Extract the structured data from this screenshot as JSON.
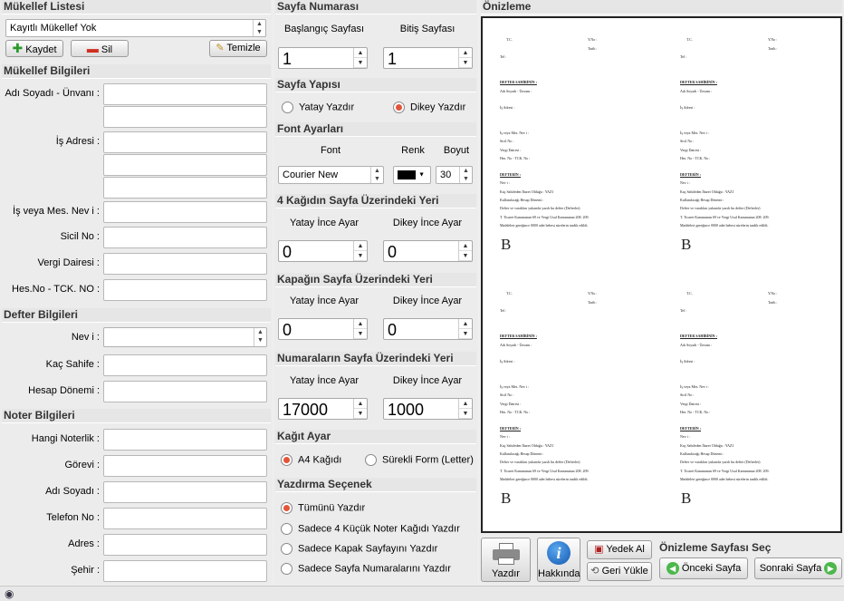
{
  "mukellef_listesi": {
    "title": "Mükellef Listesi",
    "selected": "Kayıtlı Mükellef Yok",
    "kaydet": "Kaydet",
    "sil": "Sil",
    "temizle": "Temizle"
  },
  "mukellef_bilgileri": {
    "title": "Mükellef Bilgileri",
    "ad_soyad": "Adı Soyadı - Ünvanı :",
    "is_adresi": "İş Adresi :",
    "mes_nev": "İş veya Mes. Nev i :",
    "sicil": "Sicil No :",
    "vergi": "Vergi Dairesi :",
    "hes_no": "Hes.No - TCK. NO :"
  },
  "defter_bilgileri": {
    "title": "Defter Bilgileri",
    "nevi": "Nev i :",
    "kac_sahife": "Kaç Sahife :",
    "hesap_donemi": "Hesap Dönemi :"
  },
  "noter_bilgileri": {
    "title": "Noter Bilgileri",
    "hangi_noterlik": "Hangi Noterlik :",
    "gorevi": "Görevi :",
    "adi_soyadi": "Adı Soyadı :",
    "telefon": "Telefon No :",
    "adres": "Adres :",
    "sehir": "Şehir :"
  },
  "sayfa_numarasi": {
    "title": "Sayfa Numarası",
    "baslangic": "Başlangıç Sayfası",
    "bitis": "Bitiş Sayfası",
    "baslangic_val": "1",
    "bitis_val": "1"
  },
  "sayfa_yapisi": {
    "title": "Sayfa Yapısı",
    "yatay": "Yatay Yazdır",
    "dikey": "Dikey Yazdır"
  },
  "font_ayarlari": {
    "title": "Font Ayarları",
    "font": "Font",
    "renk": "Renk",
    "boyut": "Boyut",
    "font_val": "Courier New",
    "boyut_val": "30",
    "renk_val": "#000000"
  },
  "kagit_yeri": {
    "title": "4 Kağıdın Sayfa Üzerindeki Yeri",
    "yatay": "Yatay İnce Ayar",
    "dikey": "Dikey İnce Ayar",
    "yatay_val": "0",
    "dikey_val": "0"
  },
  "kapak_yeri": {
    "title": "Kapağın Sayfa Üzerindeki Yeri",
    "yatay": "Yatay İnce Ayar",
    "dikey": "Dikey İnce Ayar",
    "yatay_val": "0",
    "dikey_val": "0"
  },
  "numara_yeri": {
    "title": "Numaraların Sayfa Üzerindeki Yeri",
    "yatay": "Yatay İnce Ayar",
    "dikey": "Dikey İnce Ayar",
    "yatay_val": "17000",
    "dikey_val": "1000"
  },
  "kagit_ayar": {
    "title": "Kağıt Ayar",
    "a4": "A4 Kağıdı",
    "surekli": "Sürekli Form (Letter)"
  },
  "yazdirma_secenek": {
    "title": "Yazdırma Seçenek",
    "opt1": "Tümünü Yazdır",
    "opt2": "Sadece 4 Küçük Noter Kağıdı Yazdır",
    "opt3": "Sadece Kapak Sayfayını Yazdır",
    "opt4": "Sadece Sayfa Numaralarını Yazdır"
  },
  "onizleme": {
    "title": "Önizleme",
    "page": {
      "tc": "T.C.",
      "yno": "Y.No :",
      "tarih": "Tarih :",
      "tel": "Tel :",
      "defter_sahibinin": "DEFTER SAHİBİNİN :",
      "adi_soyadi": "Adı Soyadı - Ünvanı :",
      "is_adresi": "İş Adresi :",
      "mes_nev": "İş veya Mes. Nev i :",
      "sicil": "Sicil No :",
      "vergi": "Vergi Dairesi :",
      "hes_no": "Hes. No - TCK. No :",
      "defterin": "DEFTERİN :",
      "nevi": "Nev i :",
      "line1": "Kaç Sahifeden İbaret Olduğu :  YAZI",
      "line2": "Kullanılacağı Hesap Dönemi :",
      "line3": "Defter ve varakları yukarıda yazılı bu defter (Defterler)",
      "line4": "T. Ticaret Kanununun 69 ve Vergi Usul Kanununun 208. 209.",
      "line5": "Maddeleri gereğince 0000 adet behest sürelerin tasdik edildi.",
      "letter": "B"
    }
  },
  "toolbar": {
    "yazdir": "Yazdır",
    "hakkinda": "Hakkında",
    "yedek_al": "Yedek Al",
    "geri_yukle": "Geri Yükle",
    "onizleme_sec": "Önizleme Sayfası Seç",
    "onceki": "Önceki Sayfa",
    "sonraki": "Sonraki Sayfa"
  }
}
